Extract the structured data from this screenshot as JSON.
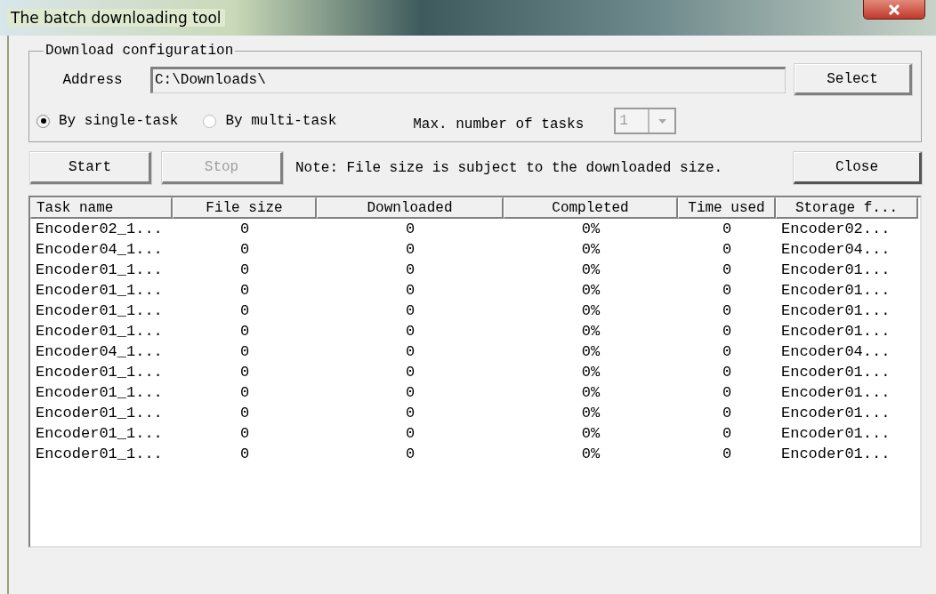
{
  "window": {
    "title": "The batch downloading tool"
  },
  "config": {
    "legend": "Download configuration",
    "address_label": "Address",
    "address_value": "C:\\Downloads\\",
    "select_button": "Select",
    "modes": [
      {
        "label": "By single-task",
        "selected": true
      },
      {
        "label": "By multi-task",
        "selected": false
      }
    ],
    "max_tasks_label": "Max. number of tasks",
    "max_tasks": {
      "value": "1",
      "disabled": true
    }
  },
  "actions": {
    "buttons": [
      {
        "label": "Start",
        "disabled": false
      },
      {
        "label": "Stop",
        "disabled": true
      }
    ],
    "note": "Note: File size is subject to the downloaded size.",
    "close_button": "Close"
  },
  "table": {
    "columns": [
      "Task name",
      "File size",
      "Downloaded",
      "Completed",
      "Time used",
      "Storage f..."
    ],
    "rows": [
      [
        "Encoder02_1...",
        "0",
        "0",
        "0%",
        "0",
        "Encoder02..."
      ],
      [
        "Encoder04_1...",
        "0",
        "0",
        "0%",
        "0",
        "Encoder04..."
      ],
      [
        "Encoder01_1...",
        "0",
        "0",
        "0%",
        "0",
        "Encoder01..."
      ],
      [
        "Encoder01_1...",
        "0",
        "0",
        "0%",
        "0",
        "Encoder01..."
      ],
      [
        "Encoder01_1...",
        "0",
        "0",
        "0%",
        "0",
        "Encoder01..."
      ],
      [
        "Encoder01_1...",
        "0",
        "0",
        "0%",
        "0",
        "Encoder01..."
      ],
      [
        "Encoder04_1...",
        "0",
        "0",
        "0%",
        "0",
        "Encoder04..."
      ],
      [
        "Encoder01_1...",
        "0",
        "0",
        "0%",
        "0",
        "Encoder01..."
      ],
      [
        "Encoder01_1...",
        "0",
        "0",
        "0%",
        "0",
        "Encoder01..."
      ],
      [
        "Encoder01_1...",
        "0",
        "0",
        "0%",
        "0",
        "Encoder01..."
      ],
      [
        "Encoder01_1...",
        "0",
        "0",
        "0%",
        "0",
        "Encoder01..."
      ],
      [
        "Encoder01_1...",
        "0",
        "0",
        "0%",
        "0",
        "Encoder01..."
      ]
    ]
  }
}
